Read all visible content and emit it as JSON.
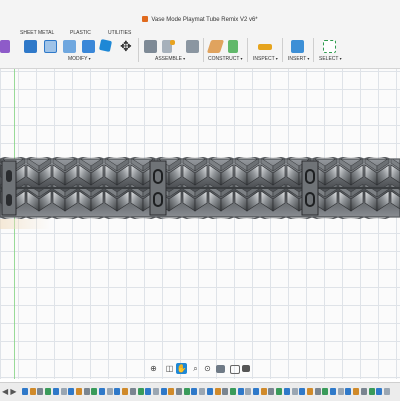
{
  "window": {
    "title": "Vase Mode Playmat Tube Remix V2 v6*"
  },
  "ribbon": {
    "tabs": [
      "SHEET METAL",
      "PLASTIC",
      "UTILITIES"
    ],
    "groups": [
      "MODIFY",
      "ASSEMBLE",
      "CONSTRUCT",
      "INSPECT",
      "INSERT",
      "SELECT"
    ]
  },
  "colors": {
    "accent": "#1e88d6",
    "model": "#5b5e62",
    "axis_y": "#7fd27f",
    "title_icon": "#e06a1e"
  },
  "model": {
    "name": "playmat-tube-braided",
    "shading": "metallic-grey"
  },
  "navbar": {
    "icons": [
      "orbit-icon",
      "look-at-icon",
      "pan-icon",
      "zoom-icon",
      "zoom-window-icon",
      "display-settings-icon",
      "grid-settings-icon",
      "viewports-icon"
    ],
    "active": "pan-icon"
  },
  "timeline": {
    "item_count": 48
  }
}
